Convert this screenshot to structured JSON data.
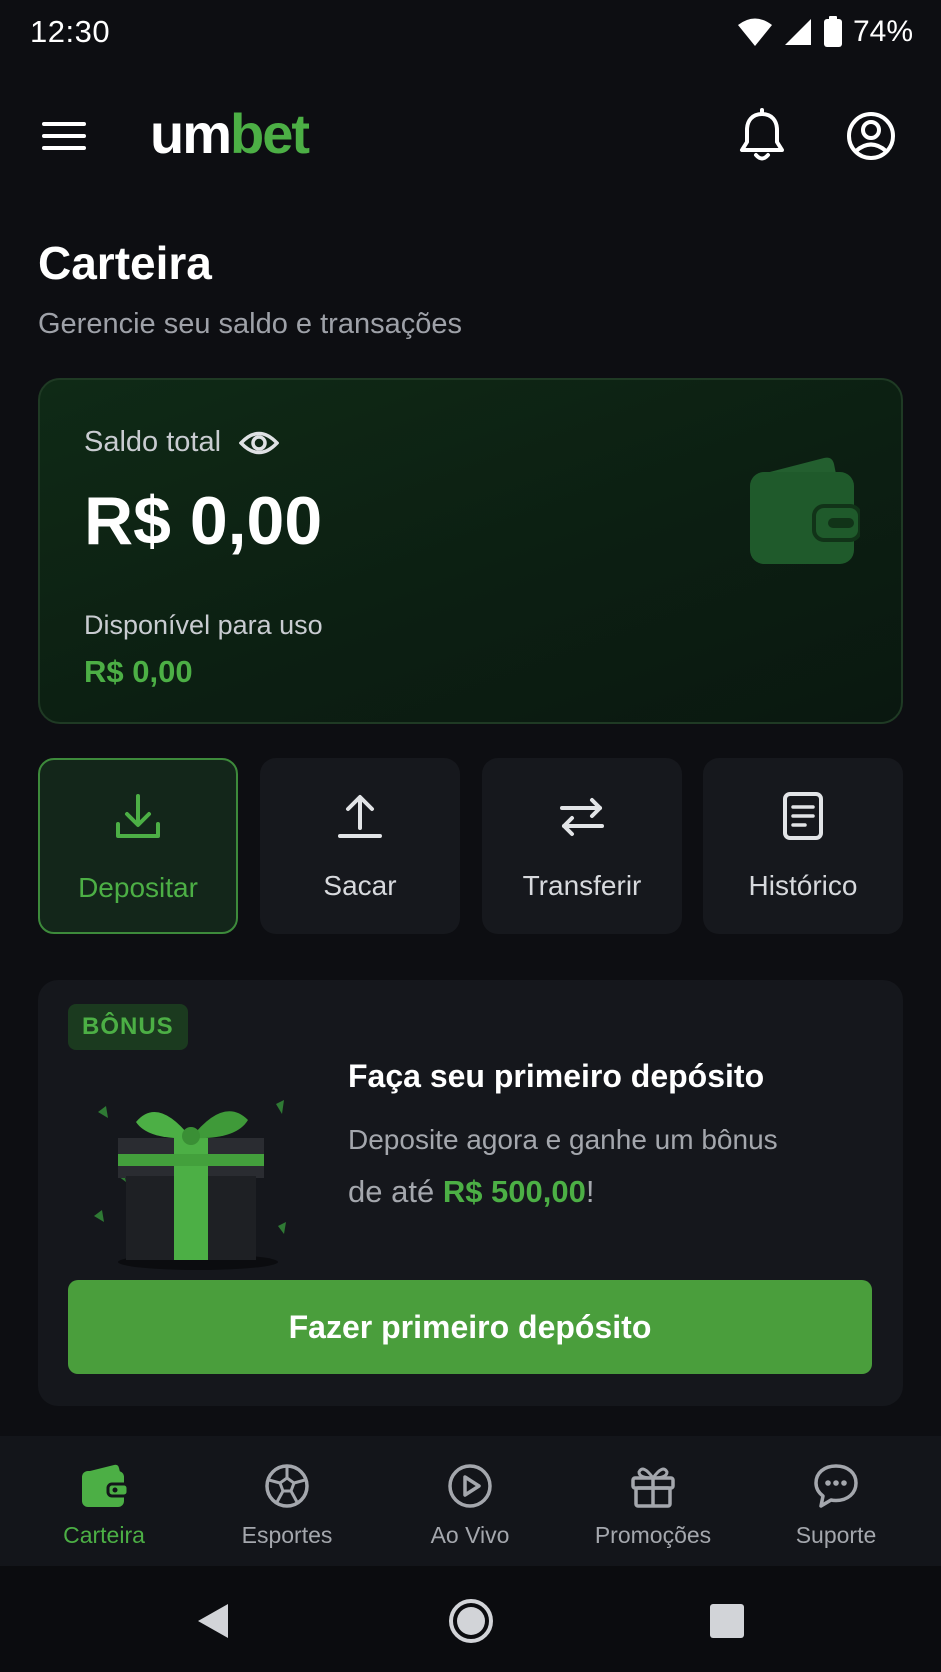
{
  "status_bar": {
    "time": "12:30",
    "battery": "74%"
  },
  "app_bar": {
    "logo_um": "um",
    "logo_bet": "bet"
  },
  "page": {
    "title": "Carteira",
    "subtitle": "Gerencie seu saldo e transações"
  },
  "balance": {
    "label": "Saldo total",
    "value": "R$ 0,00",
    "available_label": "Disponível para uso",
    "available_value": "R$ 0,00"
  },
  "actions": [
    {
      "label": "Depositar",
      "icon": "download-icon"
    },
    {
      "label": "Sacar",
      "icon": "upload-icon"
    },
    {
      "label": "Transferir",
      "icon": "transfer-icon"
    },
    {
      "label": "Histórico",
      "icon": "history-icon"
    }
  ],
  "bonus": {
    "badge": "BÔNUS",
    "title": "Faça seu primeiro depósito",
    "desc_line1": "Deposite agora e ganhe um bônus",
    "desc_line2_prefix": "de até ",
    "desc_amount": "R$ 500,00",
    "desc_suffix": "!",
    "cta": "Fazer primeiro depósito"
  },
  "bottom_nav": [
    {
      "label": "Carteira",
      "icon": "wallet-icon",
      "active": true
    },
    {
      "label": "Esportes",
      "icon": "soccer-ball-icon",
      "active": false
    },
    {
      "label": "Ao Vivo",
      "icon": "play-icon",
      "active": false
    },
    {
      "label": "Promoções",
      "icon": "gift-icon",
      "active": false
    },
    {
      "label": "Suporte",
      "icon": "chat-icon",
      "active": false
    }
  ],
  "colors": {
    "accent": "#4caf45",
    "background": "#0d0e12",
    "card": "#16181d"
  }
}
